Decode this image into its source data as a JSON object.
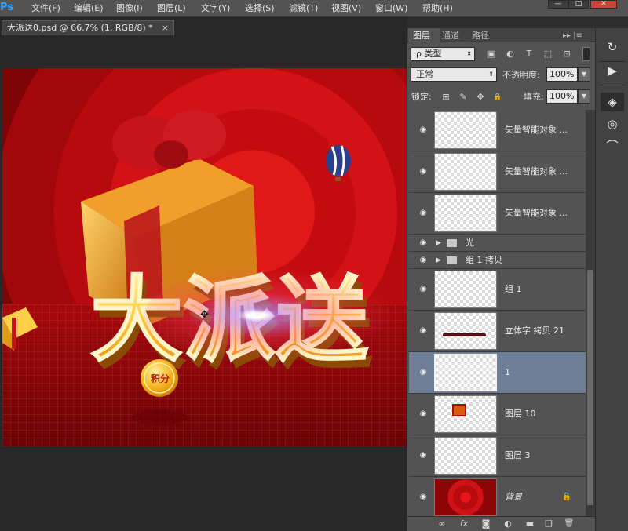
{
  "app": {
    "logo": "Ps"
  },
  "menu": [
    "文件(F)",
    "编辑(E)",
    "图像(I)",
    "图层(L)",
    "文字(Y)",
    "选择(S)",
    "滤镜(T)",
    "视图(V)",
    "窗口(W)",
    "帮助(H)"
  ],
  "window_controls": {
    "minimize": "—",
    "maximize": "□",
    "close": "✕"
  },
  "document": {
    "tab_title": "大派送0.psd @ 66.7% (1, RGB/8) *",
    "close": "×"
  },
  "canvas_text": {
    "headline": "大派送",
    "coin": "积分"
  },
  "panel": {
    "tabs": [
      "图层",
      "通道",
      "路径"
    ],
    "active_tab": "图层",
    "menu_glyph": "▸▸ |≡",
    "filter": {
      "kind": "类型",
      "search_glyph": "ρ"
    },
    "filter_icons": {
      "pixel": "▣",
      "adjust": "◐",
      "type": "T",
      "shape": "⬚",
      "smart": "⊡"
    },
    "blend_mode": "正常",
    "opacity_label": "不透明度:",
    "opacity_value": "100%",
    "lock_label": "锁定:",
    "lock_icons": {
      "transparent": "⊞",
      "paint": "✎",
      "position": "✥",
      "all": "🔒"
    },
    "fill_label": "填充:",
    "fill_value": "100%",
    "layers": [
      {
        "name": "矢量智能对象 ...",
        "kind": "smart"
      },
      {
        "name": "矢量智能对象 ...",
        "kind": "smart"
      },
      {
        "name": "矢量智能对象 ...",
        "kind": "smart"
      },
      {
        "name": "光",
        "kind": "group"
      },
      {
        "name": "组 1 拷贝",
        "kind": "group"
      },
      {
        "name": "组 1",
        "kind": "layer"
      },
      {
        "name": "立体字 拷贝 21",
        "kind": "layer"
      },
      {
        "name": "1",
        "kind": "layer",
        "selected": true
      },
      {
        "name": "图层 10",
        "kind": "layer"
      },
      {
        "name": "图层 3",
        "kind": "layer"
      },
      {
        "name": "背景",
        "kind": "background",
        "locked": true
      }
    ],
    "bottom_icons": {
      "link": "∞",
      "fx": "fx",
      "mask": "◙",
      "adjust": "◐",
      "group": "▬",
      "new": "❑",
      "delete": "🗑"
    }
  },
  "dock_icons": [
    "history-icon",
    "actions-play-icon",
    "layers-icon",
    "channels-icon",
    "paths-icon"
  ],
  "dock_glyphs": [
    "↻",
    "▶",
    "◈",
    "◎",
    "⌒"
  ],
  "colors": {
    "selected_row": "#6e7e97",
    "panel_bg": "#535353",
    "canvas_red": "#c40c10",
    "ps_blue": "#31a8ff"
  }
}
